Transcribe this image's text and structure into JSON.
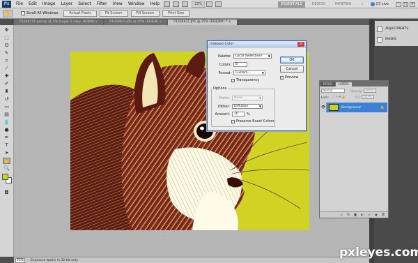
{
  "menubar": {
    "logo": "Ps",
    "items": [
      "File",
      "Edit",
      "Image",
      "Layer",
      "Select",
      "Filter",
      "View",
      "Window",
      "Help"
    ],
    "zoom": "25%",
    "workspaces": [
      "ESSENTIALS",
      "DESIGN",
      "PAINTING"
    ],
    "more": "»",
    "cs_live": "CS Live"
  },
  "options_bar": {
    "checkbox_label": "Scroll All Windows",
    "buttons": [
      "Actual Pixels",
      "Fit Screen",
      "Fill Screen",
      "Print Size"
    ]
  },
  "tabs": [
    {
      "label": "P1036711.psd @ 31.5% (Layer 1 copy, RGB/8) ×"
    },
    {
      "label": "P1036631.JPG @ 25% (RGB/8) ×"
    },
    {
      "label": "P1036631.JPG @ 25% (RGB/8#) * ×"
    }
  ],
  "status_bar": {
    "zoom": "25%",
    "message": "Exposure works in 32-bit only"
  },
  "right_dock": {
    "adjustments": "ADJUSTMENTS",
    "masks": "MASKS"
  },
  "dialog": {
    "title": "Indexed Color",
    "palette_label": "Palette:",
    "palette_value": "Local (Selective)",
    "colors_label": "Colors:",
    "colors_value": "8",
    "forced_label": "Forced:",
    "forced_value": "Custom...",
    "transparency_label": "Transparency",
    "options_legend": "Options",
    "matte_label": "Matte:",
    "matte_value": "None",
    "dither_label": "Dither:",
    "dither_value": "Diffusion",
    "amount_label": "Amount:",
    "amount_value": "10",
    "amount_unit": "%",
    "preserve_label": "Preserve Exact Colors",
    "ok": "OK",
    "cancel": "Cancel",
    "preview_label": "Preview"
  },
  "layers_panel": {
    "tabs": [
      "PATHS",
      "LAYERS"
    ],
    "blend_mode": "Normal",
    "opacity_label": "Opacity:",
    "opacity_value": "100%",
    "lock_label": "Lock:",
    "fill_label": "Fill:",
    "fill_value": "100%",
    "layer_name": "Background"
  },
  "colors": {
    "canvas_yellow": "#d0d224",
    "fur_dark": "#5b1a12",
    "fur_mid": "#8a3318",
    "highlight": "#fffbe8",
    "selection_blue": "#3b82d6"
  },
  "watermark": "pxleyes.com"
}
